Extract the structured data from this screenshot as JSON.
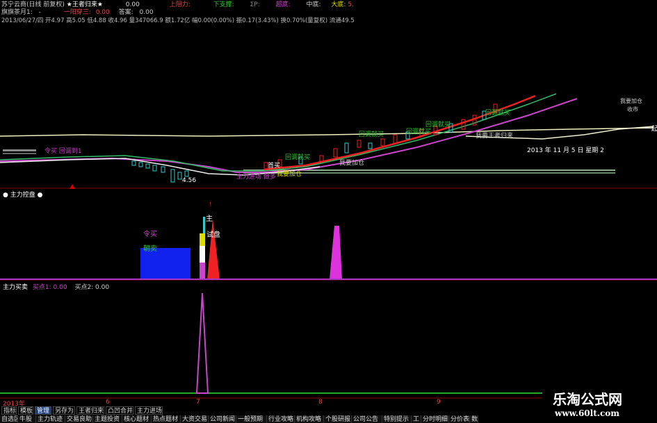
{
  "colors": {
    "bg": "#000000",
    "grid_red": "#8b0000",
    "purple": "#cc44cc",
    "green": "#22aa22",
    "yellow": "#dddd00",
    "cyan": "#33cccc",
    "red": "#ee2222",
    "blue": "#1122ee",
    "white_line": "#f0f0e0"
  },
  "header": {
    "stock_title": "苏宁云商(日线 前复权)",
    "formula_name": "★王者归来★",
    "value_a": "0.00",
    "up_resist_label": "上阻力:",
    "down_support_label": "下支撑:",
    "sigma_label": "ΣP:",
    "bottom_label": "超底:",
    "mid_label": "中底:",
    "big_label": "大底:",
    "big_value": "5.",
    "row2_label": "旗旗茶月1:",
    "row2_dash": "-",
    "row2_mid": "一阳穿三:",
    "row2_mid_val": "0.00",
    "answer_label": "答案:",
    "answer_val": "0.00",
    "row3": "2013/06/27/四 开4.97 高5.05 低4.88 收4.96 量347066.9 额1.72亿 幅0.00(0.00%) 振0.17(3.43%) 换0.70%(量复权) 流通49.5"
  },
  "main_chart": {
    "annotations": {
      "ling_mai": "令买 回调到1",
      "huidiao_jiu_mai_1": "回调就买",
      "huidiao_jiu_mai_2": "回调就买",
      "huidiao_jiu_mai_3": "回调就买",
      "huidiao_jiu_mai_4": "回调就买",
      "huidiao_jiu_mai_top": "回调就买",
      "wo_yao_jia_cang_1": "我要加仓",
      "wo_yao_jia_cang_2": "我要加仓",
      "wang_zhe_gui_lai": "我要王者归来",
      "zhuli_jin_chang": "主力进场 做多",
      "shou_mai": "首买",
      "low_price": "4.56",
      "date_label": "2013 年 11 月 5 日  星期 2",
      "right_label_1": "一起涨",
      "right_label_2": "我要加仓",
      "right_label_3": "收市"
    }
  },
  "panel2": {
    "title": "主力控盘",
    "labels": {
      "ling_mai": "令买",
      "chao_mai": "朝卖",
      "zhu": "主",
      "shi_pan": "试盘",
      "jiu": "!"
    }
  },
  "panel3": {
    "title": "主力买卖",
    "buy1": "买点1: 0.00",
    "buy2": "买点2: 0.00"
  },
  "time_axis": {
    "year": "2013年",
    "m6": "6",
    "m7": "7",
    "m8": "8",
    "m9": "9"
  },
  "bottom_tabs": [
    {
      "label": "指标",
      "active": false
    },
    {
      "label": "模板",
      "active": false
    },
    {
      "label": "管理",
      "active": true
    },
    {
      "label": "另存为",
      "active": false
    },
    {
      "label": "王者归来",
      "active": false
    },
    {
      "label": "凸凹合并",
      "active": false
    },
    {
      "label": "主力进场",
      "active": false
    }
  ],
  "menu_bar": [
    "自选区",
    "牛股",
    "主力轨迹",
    "交易良助",
    "主题投资",
    "核心题材",
    "热点题材",
    "大资交易",
    "公司新闻",
    "一般预期",
    "行业攻略",
    "机构攻略",
    "个股研报",
    "公司公告",
    "特别提示",
    "工",
    "分时明细",
    "分价表",
    "数"
  ],
  "watermark": {
    "title": "乐淘公式网",
    "url": "www.60lt.com"
  }
}
